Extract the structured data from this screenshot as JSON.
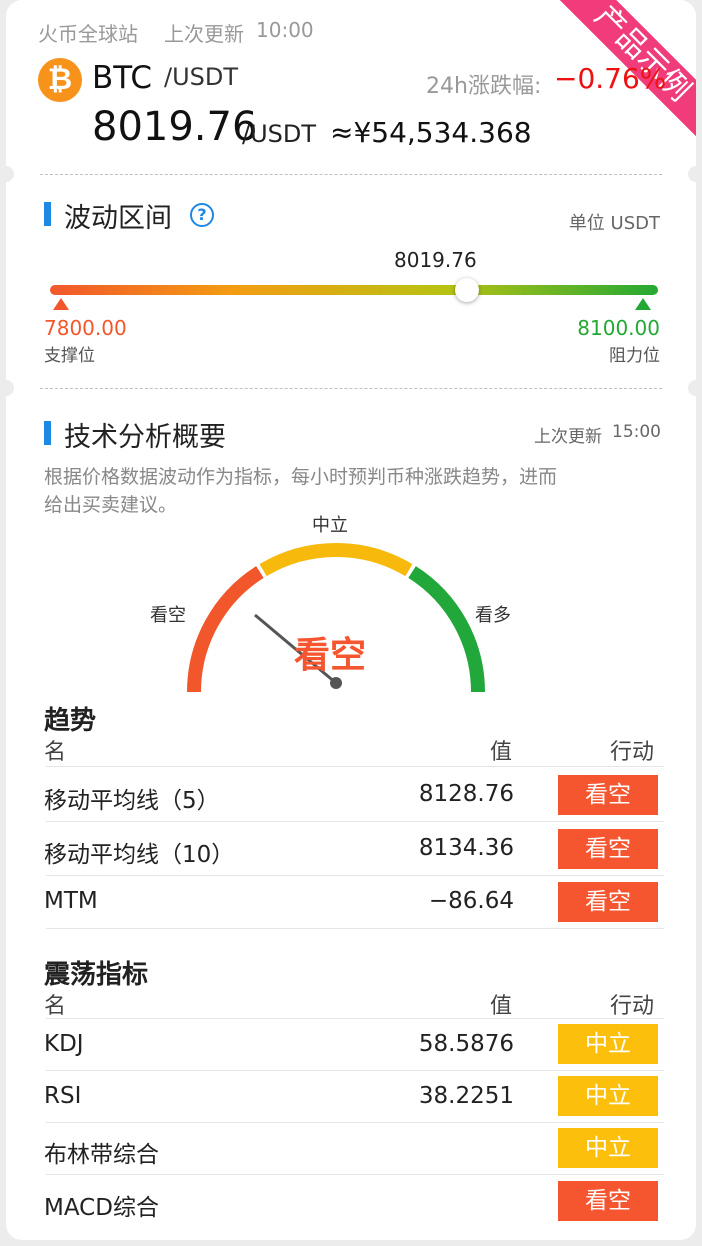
{
  "header": {
    "exchange": "火币全球站",
    "last_update_label": "上次更新",
    "last_update_time": "10:00",
    "coin_icon": "bitcoin-icon",
    "coin_glyph": "₿",
    "symbol": "BTC",
    "quote": "/USDT",
    "change_label": "24h涨跌幅:",
    "change_value": "−0.76%",
    "price": "8019.76",
    "price_unit": "/USDT",
    "price_cny": "≈¥54,534.368",
    "ribbon": "产品示例"
  },
  "range": {
    "title": "波动区间",
    "help_glyph": "?",
    "unit": "单位 USDT",
    "current": "8019.76",
    "current_fraction": 0.6866,
    "support_value": "7800.00",
    "support_label": "支撑位",
    "resistance_value": "8100.00",
    "resistance_label": "阻力位"
  },
  "analysis": {
    "title": "技术分析概要",
    "last_update_label": "上次更新",
    "last_update_time": "15:00",
    "description_line1": "根据价格数据波动作为指标，每小时预判币种涨跌趋势，进而",
    "description_line2": "给出买卖建议。",
    "gauge": {
      "label_left": "看空",
      "label_mid": "中立",
      "label_right": "看多",
      "verdict": "看空"
    }
  },
  "trend": {
    "title": "趋势",
    "col_name": "名",
    "col_value": "值",
    "col_action": "行动",
    "rows": [
      {
        "name": "移动平均线（5）",
        "value": "8128.76",
        "action": "看空"
      },
      {
        "name": "移动平均线（10）",
        "value": "8134.36",
        "action": "看空"
      },
      {
        "name": "MTM",
        "value": "−86.64",
        "action": "看空"
      }
    ]
  },
  "oscillator": {
    "title": "震荡指标",
    "col_name": "名",
    "col_value": "值",
    "col_action": "行动",
    "rows": [
      {
        "name": "KDJ",
        "value": "58.5876",
        "action": "中立"
      },
      {
        "name": "RSI",
        "value": "38.2251",
        "action": "中立"
      },
      {
        "name": "布林带综合",
        "value": "",
        "action": "中立"
      },
      {
        "name": "MACD综合",
        "value": "",
        "action": "看空"
      }
    ]
  },
  "colors": {
    "accent": "#1e88e5",
    "negative": "#ee1111",
    "support": "#f2572c",
    "resistance": "#24a834",
    "sell": "#f5552f",
    "neutral": "#fbbf0c",
    "ribbon": "#f03c7a"
  }
}
